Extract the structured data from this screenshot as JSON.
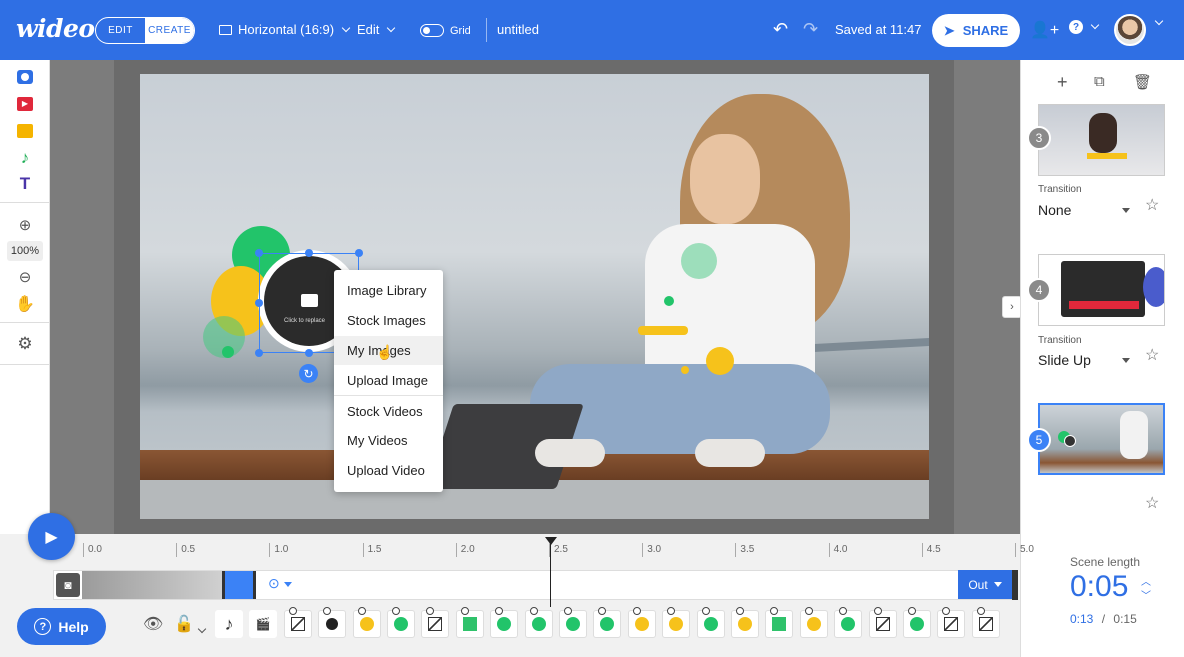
{
  "app": {
    "logo": "wideo",
    "mode_edit": "EDIT",
    "mode_create": "CREATE",
    "aspect": "Horizontal (16:9)",
    "edit_menu": "Edit",
    "grid_label": "Grid",
    "document_title": "untitled",
    "saved_status": "Saved at 11:47",
    "share_label": "SHARE",
    "accent": "#2f6fe4"
  },
  "left_toolbar": {
    "icons": [
      "camera-icon",
      "video-icon",
      "image-icon",
      "music-icon",
      "text-icon",
      "zoom-in-icon",
      "zoom-out-icon",
      "hand-icon",
      "settings-icon"
    ],
    "zoom": "100%"
  },
  "canvas": {
    "placeholder_text": "Click to replace",
    "context_menu": [
      "Image Library",
      "Stock Images",
      "My Images",
      "Upload Image",
      "Stock Videos",
      "My Videos",
      "Upload Video"
    ]
  },
  "scenes": [
    {
      "number": "3",
      "transition_label": "Transition",
      "transition": "None"
    },
    {
      "number": "4",
      "transition_label": "Transition",
      "transition": "Slide Up"
    },
    {
      "number": "5",
      "selected": true
    }
  ],
  "timeline": {
    "ticks": [
      "0.0",
      "0.5",
      "1.0",
      "1.5",
      "2.0",
      "2.5",
      "3.0",
      "3.5",
      "4.0",
      "4.5",
      "5.0"
    ],
    "out_label": "Out",
    "help_label": "Help",
    "playhead_seconds": 2.5
  },
  "scene_length": {
    "label": "Scene length",
    "value": "0:05",
    "current": "0:13",
    "separator": "/",
    "total": "0:15"
  }
}
